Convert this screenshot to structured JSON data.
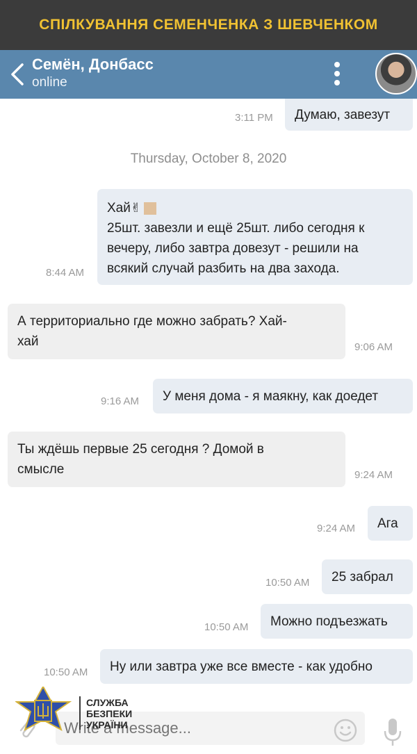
{
  "banner": {
    "text": "СПІЛКУВАННЯ СЕМЕНЧЕНКА З ШЕВЧЕНКОМ",
    "color": "#f1c232"
  },
  "header": {
    "title": "Семён, Донбасс",
    "status": "online",
    "back_icon": "chevron-left-icon",
    "menu_icon": "vertical-dots-icon",
    "bg": "#5a87ad"
  },
  "date_separator": "Thursday, October 8, 2020",
  "messages": [
    {
      "dir": "out",
      "text": "Думаю, завезут",
      "time": "3:11 PM"
    },
    {
      "dir": "out",
      "lines": [
        "Хай",
        "25шт. завезли и ещё 25шт. либо сегодня к",
        "вечеру, либо завтра довезут - решили на",
        "всякий случай разбить на два захода."
      ],
      "time": "8:44 AM"
    },
    {
      "dir": "in",
      "lines": [
        "А территориально где можно забрать? Хай-",
        "хай"
      ],
      "time": "9:06 AM"
    },
    {
      "dir": "out",
      "text": "У меня дома - я маякну, как доедет",
      "time": "9:16 AM"
    },
    {
      "dir": "in",
      "lines": [
        "Ты ждёшь первые 25 сегодня ? Домой в",
        "смысле"
      ],
      "time": "9:24 AM"
    },
    {
      "dir": "out",
      "text": "Ага",
      "time": "9:24 AM"
    },
    {
      "dir": "out",
      "text": "25 забрал",
      "time": "10:50 AM"
    },
    {
      "dir": "out",
      "text": "Можно подъезжать",
      "time": "10:50 AM"
    },
    {
      "dir": "out",
      "text": "Ну или завтра уже все вместе - как удобно",
      "time": "10:50 AM"
    }
  ],
  "composer": {
    "placeholder": "Write a message...",
    "attach_icon": "paperclip-icon",
    "emoji_icon": "smile-icon",
    "mic_icon": "microphone-icon"
  },
  "watermark": {
    "line1": "СЛУЖБА",
    "line2": "БЕЗПЕКИ",
    "line3": "УКРАЇНИ"
  }
}
